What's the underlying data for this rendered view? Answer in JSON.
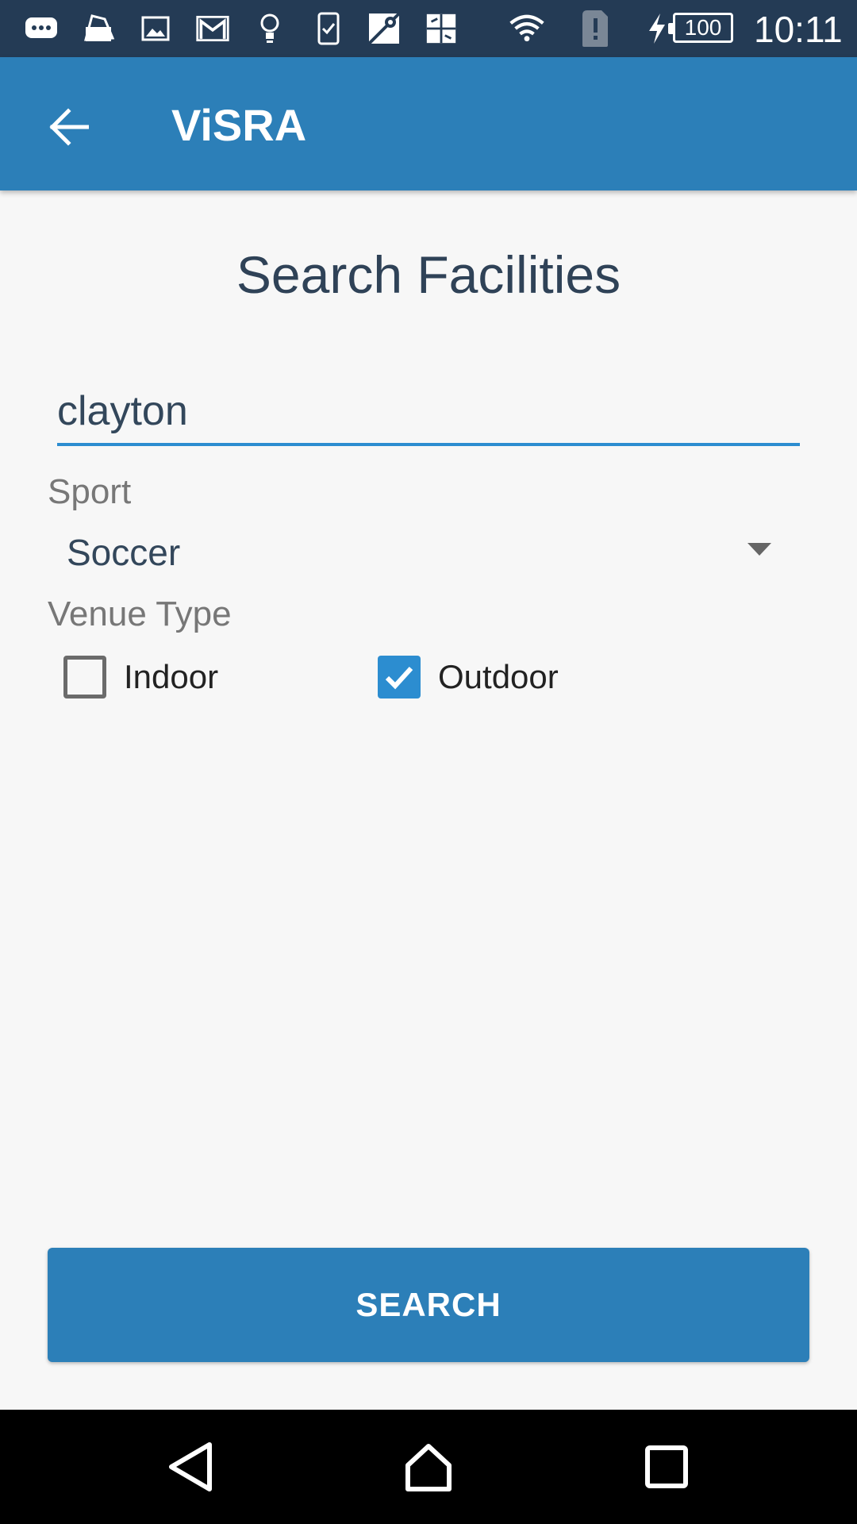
{
  "status_bar": {
    "notification_icons": [
      "chat-bubble-icon",
      "cards-icon",
      "image-icon",
      "gmail-icon",
      "lightbulb-icon",
      "clipboard-check-icon",
      "maps-icon",
      "photo-collage-icon"
    ],
    "system_icons": [
      "wifi-icon",
      "sim-alert-icon",
      "charging-bolt-icon"
    ],
    "battery_level": "100",
    "time": "10:11"
  },
  "app_bar": {
    "title": "ViSRA",
    "back_icon": "arrow-back-icon"
  },
  "main": {
    "page_title": "Search Facilities",
    "search_input": {
      "value": "clayton"
    },
    "sport": {
      "label": "Sport",
      "selected": "Soccer"
    },
    "venue_type": {
      "label": "Venue Type",
      "options": [
        {
          "label": "Indoor",
          "checked": false
        },
        {
          "label": "Outdoor",
          "checked": true
        }
      ]
    },
    "search_button_label": "SEARCH"
  },
  "colors": {
    "primary": "#2c7fb8",
    "accent": "#2c8dd0",
    "status_bar": "#243b55",
    "text_dark": "#2f4257"
  },
  "nav_bar": {
    "buttons": [
      "back-nav-icon",
      "home-nav-icon",
      "recents-nav-icon"
    ]
  }
}
